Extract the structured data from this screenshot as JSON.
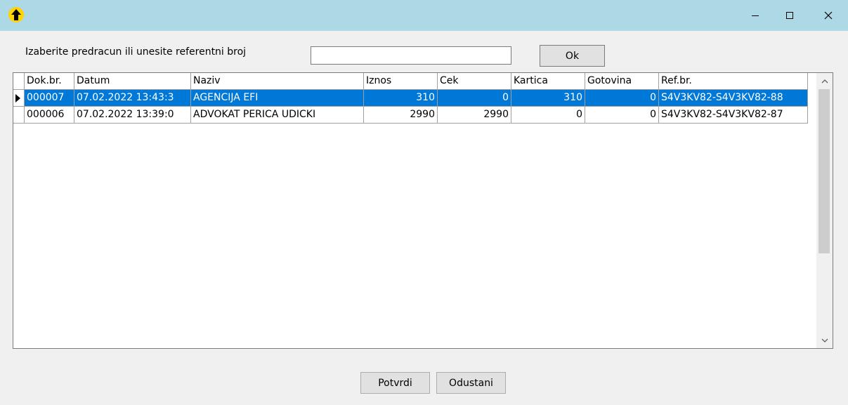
{
  "window": {
    "icon": "up-arrow-icon",
    "controls": {
      "minimize": "minimize-icon",
      "maximize": "maximize-icon",
      "close": "close-icon"
    }
  },
  "prompt": {
    "label": "Izaberite predracun ili unesite referentni broj"
  },
  "ref_input": {
    "value": "",
    "placeholder": ""
  },
  "buttons": {
    "ok": "Ok",
    "confirm": "Potvrdi",
    "cancel": "Odustani"
  },
  "table": {
    "columns": [
      "Dok.br.",
      "Datum",
      "Naziv",
      "Iznos",
      "Cek",
      "Kartica",
      "Gotovina",
      "Ref.br."
    ],
    "rows": [
      {
        "dok": "000007",
        "datum": "07.02.2022 13:43:3",
        "naziv": "AGENCIJA EFI",
        "iznos": "310",
        "cek": "0",
        "kartica": "310",
        "gotovina": "0",
        "ref": "S4V3KV82-S4V3KV82-88"
      },
      {
        "dok": "000006",
        "datum": "07.02.2022 13:39:0",
        "naziv": "ADVOKAT PERICA UDICKI",
        "iznos": "2990",
        "cek": "2990",
        "kartica": "0",
        "gotovina": "0",
        "ref": "S4V3KV82-S4V3KV82-87"
      }
    ],
    "selected_row": 0
  },
  "colors": {
    "titlebar": "#add8e6",
    "selection": "#0078d7",
    "app_icon": "#ffd400"
  }
}
